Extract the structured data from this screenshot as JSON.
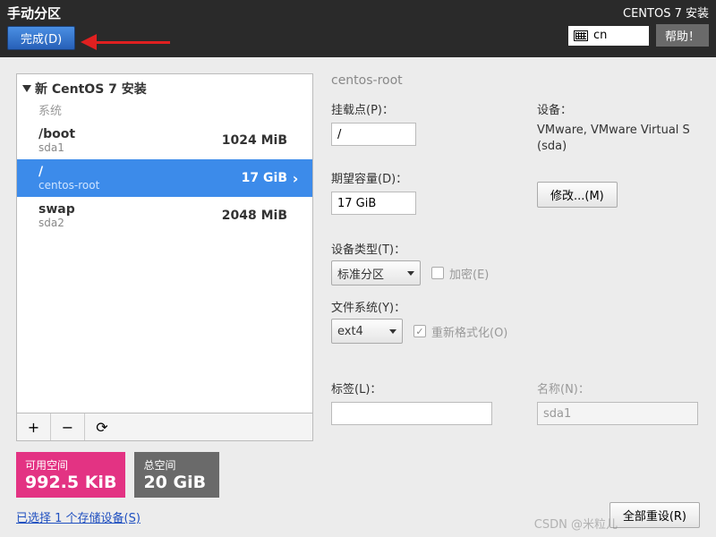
{
  "header": {
    "title": "手动分区",
    "done": "完成(D)",
    "installer": "CENTOS 7 安装",
    "lang": "cn",
    "help": "帮助！"
  },
  "left": {
    "group": "新 CentOS 7 安装",
    "system_label": "系统",
    "partitions": [
      {
        "mount": "/boot",
        "dev": "sda1",
        "size": "1024 MiB",
        "selected": false
      },
      {
        "mount": "/",
        "dev": "centos-root",
        "size": "17 GiB",
        "selected": true
      },
      {
        "mount": "swap",
        "dev": "sda2",
        "size": "2048 MiB",
        "selected": false
      }
    ],
    "btn_add": "+",
    "btn_remove": "−",
    "btn_reload": "⟳",
    "free_label": "可用空间",
    "free_value": "992.5 KiB",
    "total_label": "总空间",
    "total_value": "20 GiB",
    "storage_link": "已选择 1 个存储设备(S)"
  },
  "right": {
    "title": "centos-root",
    "mount_label": "挂载点(P)：",
    "mount_value": "/",
    "capacity_label": "期望容量(D)：",
    "capacity_value": "17 GiB",
    "devices_label": "设备：",
    "devices_text": "VMware, VMware Virtual S (sda)",
    "modify_btn": "修改...(M)",
    "devtype_label": "设备类型(T)：",
    "devtype_value": "标准分区",
    "encrypt_label": "加密(E)",
    "fs_label": "文件系统(Y)：",
    "fs_value": "ext4",
    "reformat_label": "重新格式化(O)",
    "label_label": "标签(L)：",
    "label_value": "",
    "name_label": "名称(N)：",
    "name_value": "sda1",
    "reset_btn": "全部重设(R)"
  },
  "watermark": "CSDN @米粒儿"
}
